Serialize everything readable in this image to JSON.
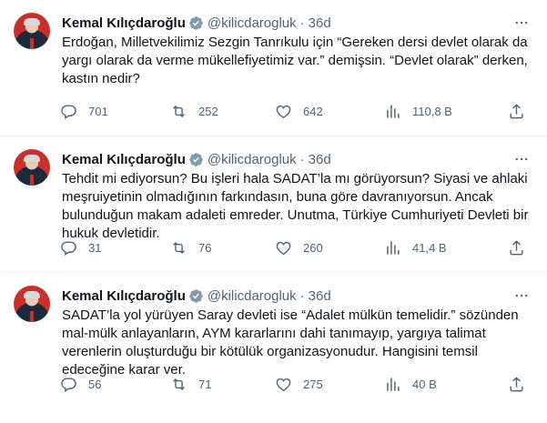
{
  "tweets": [
    {
      "author": "Kemal Kılıçdaroğlu",
      "handle": "@kilicdarogluk",
      "separator": "·",
      "time": "36d",
      "text": "Erdoğan, Milletvekilimiz Sezgin Tanrıkulu için “Gereken dersi devlet olarak da yargı olarak da verme mükellefiyetimiz var.” demişsin. “Devlet olarak” derken, kastın nedir?",
      "replies": "701",
      "retweets": "252",
      "likes": "642",
      "views": "110,8 B"
    },
    {
      "author": "Kemal Kılıçdaroğlu",
      "handle": "@kilicdarogluk",
      "separator": "·",
      "time": "36d",
      "text": "Tehdit mi ediyorsun? Bu işleri hala SADAT’la mı görüyorsun? Siyasi ve ahlaki meşruiyetinin olmadığının farkındasın, buna göre davranıyorsun. Ancak bulunduğun makam adaleti emreder. Unutma, Türkiye Cumhuriyeti Devleti bir hukuk devletidir.",
      "replies": "31",
      "retweets": "76",
      "likes": "260",
      "views": "41,4 B"
    },
    {
      "author": "Kemal Kılıçdaroğlu",
      "handle": "@kilicdarogluk",
      "separator": "·",
      "time": "36d",
      "text": "SADAT’la yol yürüyen Saray devleti ise “Adalet mülkün temelidir.” sözünden mal-mülk anlayanların, AYM kararlarını dahi tanımayıp, yargıya talimat verenlerin oluşturduğu bir kötülük organizasyonudur. Hangisini temsil edeceğine karar ver.",
      "replies": "56",
      "retweets": "71",
      "likes": "275",
      "views": "40 B"
    }
  ],
  "icons": {
    "verified": "verified-badge-icon",
    "more": "more-horizontal-icon",
    "reply": "reply-icon",
    "retweet": "retweet-icon",
    "like": "like-heart-icon",
    "views": "views-bar-chart-icon",
    "share": "share-upload-icon"
  },
  "colors": {
    "text_primary": "#0f1419",
    "text_secondary": "#536471",
    "verified_badge": "#829aab",
    "divider": "#eff3f4"
  }
}
